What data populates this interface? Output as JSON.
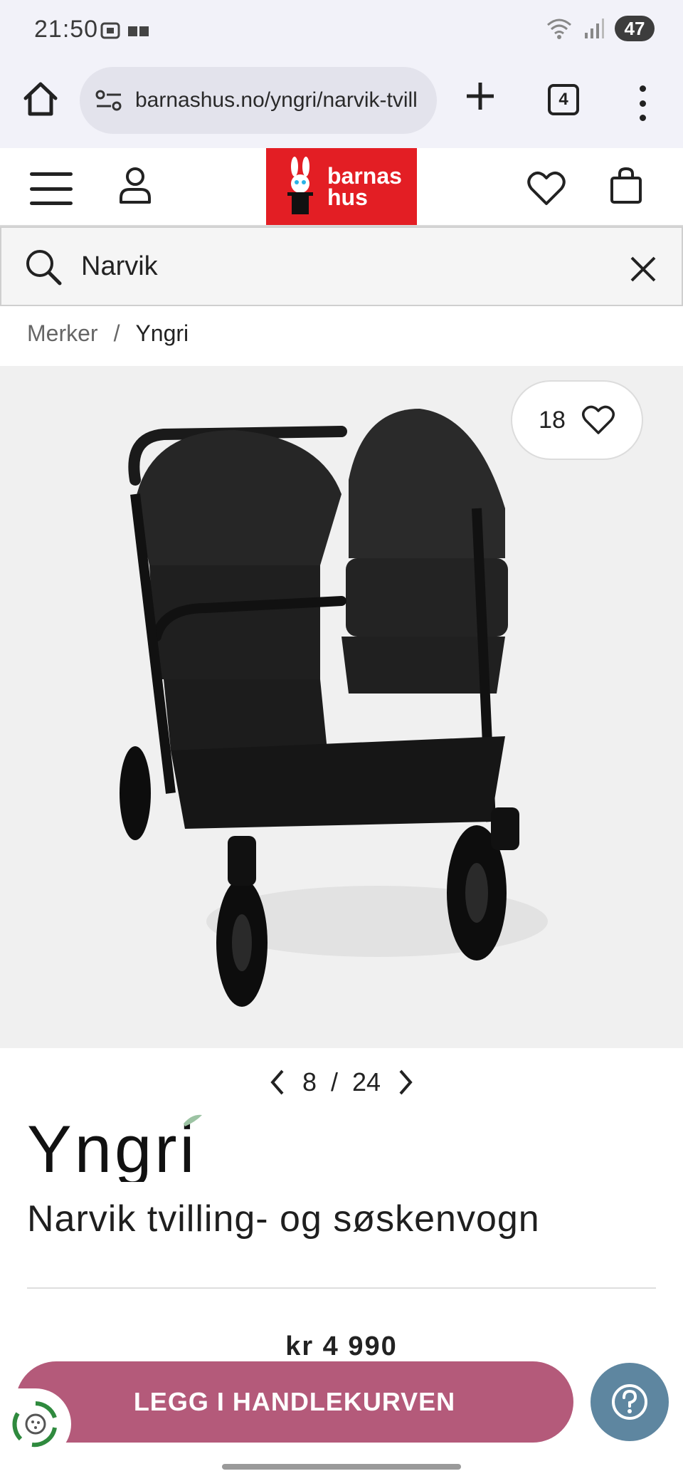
{
  "status_bar": {
    "time": "21:50",
    "battery": "47"
  },
  "browser": {
    "url": "barnashus.no/yngri/narvik-tvill",
    "tab_count": "4"
  },
  "header": {
    "logo_line1": "barnas",
    "logo_line2": "hus",
    "logo_color": "#e31e24"
  },
  "search": {
    "value": "Narvik"
  },
  "breadcrumb": {
    "items": [
      "Merker",
      "Yngri"
    ],
    "separator": "/"
  },
  "product": {
    "favorites_count": "18",
    "image_index": "8",
    "image_total": "24",
    "pager_separator": "/",
    "brand": "Yngri",
    "title": "Narvik tvilling- og søskenvogn",
    "price": "kr 4 990"
  },
  "actions": {
    "add_to_cart": "LEGG I HANDLEKURVEN",
    "cart_button_color": "#b45a7a",
    "help_button_color": "#5e86a0"
  }
}
